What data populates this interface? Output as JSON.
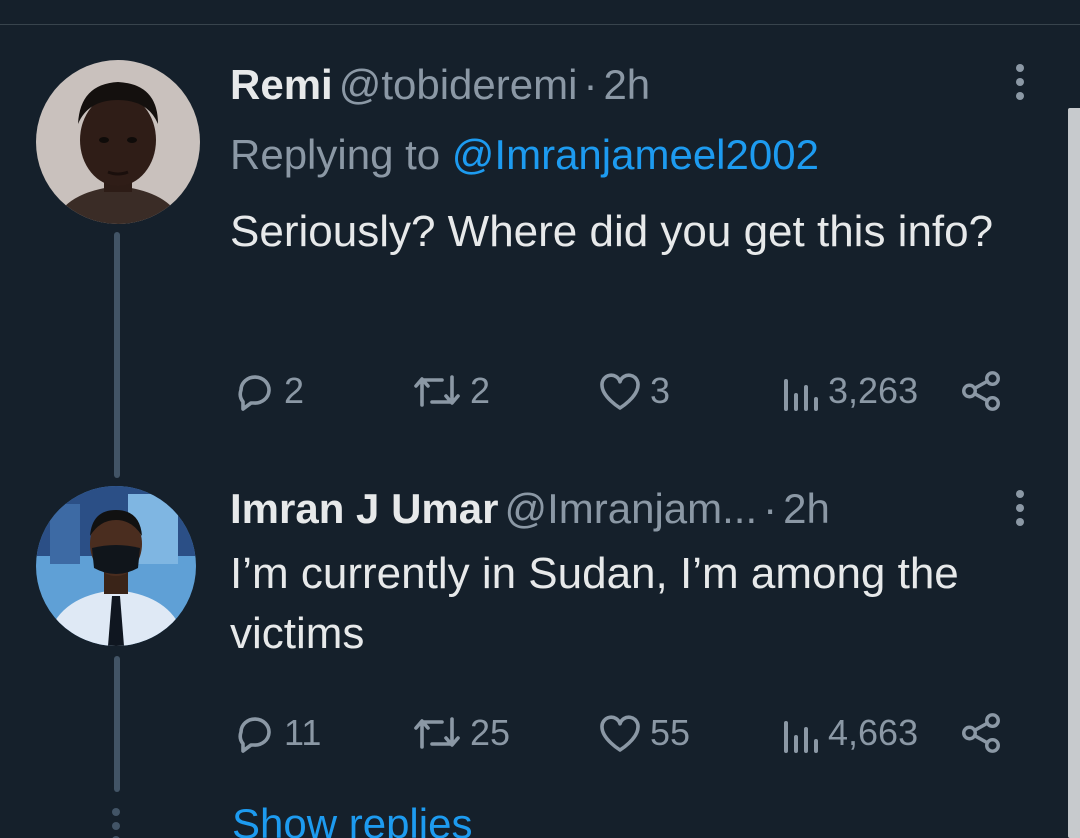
{
  "tweets": [
    {
      "name": "Remi",
      "handle": "@tobideremi",
      "separator": "·",
      "time": "2h",
      "replying_prefix": "Replying to",
      "replying_handle": "@Imranjameel2002",
      "text": "Seriously? Where did you get this info?",
      "replies": "2",
      "retweets": "2",
      "likes": "3",
      "views": "3,263"
    },
    {
      "name": "Imran J Umar",
      "handle": "@Imranjam...",
      "separator": "·",
      "time": "2h",
      "text": "I’m currently in Sudan, I’m among the victims",
      "replies": "11",
      "retweets": "25",
      "likes": "55",
      "views": "4,663"
    }
  ],
  "show_replies": "Show replies",
  "colors": {
    "background": "#15202b",
    "primary_text": "#e7e9ea",
    "secondary_text": "#8b98a5",
    "accent": "#1d9bf0",
    "thread_line": "#425466"
  },
  "icons": [
    "reply-icon",
    "retweet-icon",
    "like-icon",
    "views-icon",
    "share-icon",
    "more-icon"
  ]
}
